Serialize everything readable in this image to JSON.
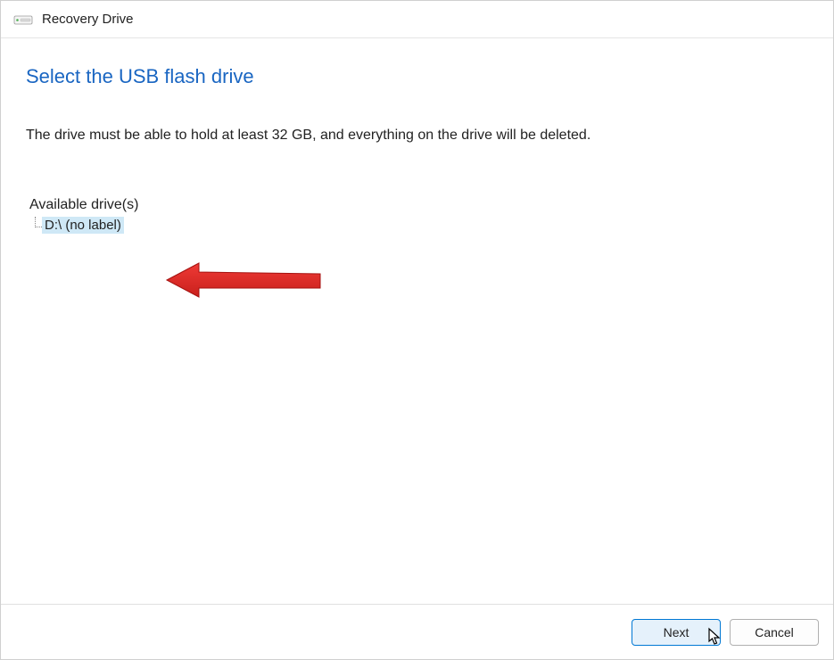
{
  "window": {
    "title": "Recovery Drive"
  },
  "page": {
    "heading": "Select the USB flash drive",
    "description": "The drive must be able to hold at least 32 GB, and everything on the drive will be deleted."
  },
  "drives": {
    "label": "Available drive(s)",
    "items": [
      {
        "label": "D:\\ (no label)",
        "selected": true
      }
    ]
  },
  "buttons": {
    "next": "Next",
    "cancel": "Cancel"
  }
}
